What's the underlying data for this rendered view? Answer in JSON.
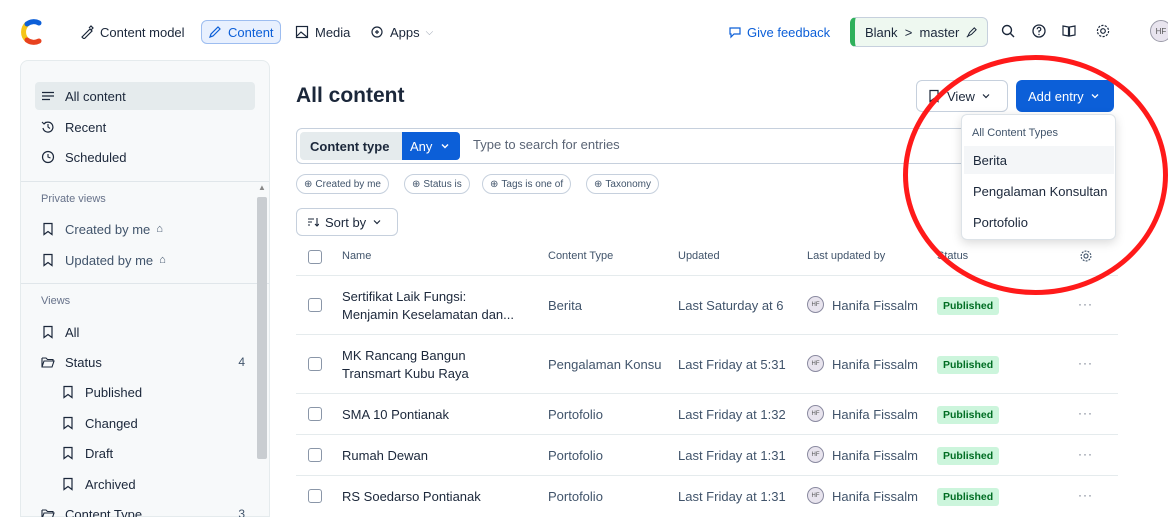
{
  "topbar": {
    "nav": [
      {
        "label": "Content model",
        "icon": "pencil-ruler-icon"
      },
      {
        "label": "Content",
        "icon": "pen-icon",
        "active": true
      },
      {
        "label": "Media",
        "icon": "image-icon"
      },
      {
        "label": "Apps",
        "icon": "apps-icon"
      }
    ],
    "feedback_label": "Give feedback",
    "environment_label": "Blank  >  master",
    "avatar_initials": "HF"
  },
  "sidebar": {
    "top_items": [
      {
        "label": "All content",
        "icon": "list-icon",
        "active": true
      },
      {
        "label": "Recent",
        "icon": "history-icon"
      },
      {
        "label": "Scheduled",
        "icon": "clock-icon"
      }
    ],
    "private_heading": "Private views",
    "private_items": [
      {
        "label": "Created by me",
        "lock": "⌂"
      },
      {
        "label": "Updated by me",
        "lock": "⌂"
      }
    ],
    "views_heading": "Views",
    "views_items": [
      {
        "label": "All"
      },
      {
        "label": "Status",
        "count": "4"
      },
      {
        "label": "Published"
      },
      {
        "label": "Changed"
      },
      {
        "label": "Draft"
      },
      {
        "label": "Archived"
      },
      {
        "label": "Content Type",
        "count": "3"
      }
    ]
  },
  "main": {
    "title": "All content",
    "view_label": "View",
    "add_entry_label": "Add entry",
    "search": {
      "content_type_label": "Content type",
      "content_type_value": "Any",
      "placeholder": "Type to search for entries"
    },
    "filters": [
      "Created by me",
      "Status is",
      "Tags is one of",
      "Taxonomy"
    ],
    "sort_label": "Sort by",
    "table": {
      "headers": [
        "Name",
        "Content Type",
        "Updated",
        "Last updated by",
        "Status"
      ],
      "rows": [
        {
          "name_line1": "Sertifikat Laik Fungsi:",
          "name_line2": "Menjamin Keselamatan dan...",
          "type": "Berita",
          "updated": "Last Saturday at 6",
          "user": "Hanifa Fissalm",
          "status": "Published"
        },
        {
          "name_line1": "MK Rancang Bangun",
          "name_line2": "Transmart Kubu Raya",
          "type": "Pengalaman Konsu",
          "updated": "Last Friday at 5:31",
          "user": "Hanifa Fissalm",
          "status": "Published"
        },
        {
          "name_line1": "SMA 10 Pontianak",
          "name_line2": "",
          "type": "Portofolio",
          "updated": "Last Friday at 1:32",
          "user": "Hanifa Fissalm",
          "status": "Published"
        },
        {
          "name_line1": "Rumah Dewan",
          "name_line2": "",
          "type": "Portofolio",
          "updated": "Last Friday at 1:31",
          "user": "Hanifa Fissalm",
          "status": "Published"
        },
        {
          "name_line1": "RS Soedarso Pontianak",
          "name_line2": "",
          "type": "Portofolio",
          "updated": "Last Friday at 1:31",
          "user": "Hanifa Fissalm",
          "status": "Published"
        }
      ]
    }
  },
  "dropdown": {
    "heading": "All Content Types",
    "items": [
      "Berita",
      "Pengalaman Konsultan",
      "Portofolio"
    ]
  },
  "colors": {
    "primary": "#0c5fd8",
    "published_bg": "#ccf5dc",
    "published_text": "#006d23",
    "annotation": "#ff1a1a"
  }
}
